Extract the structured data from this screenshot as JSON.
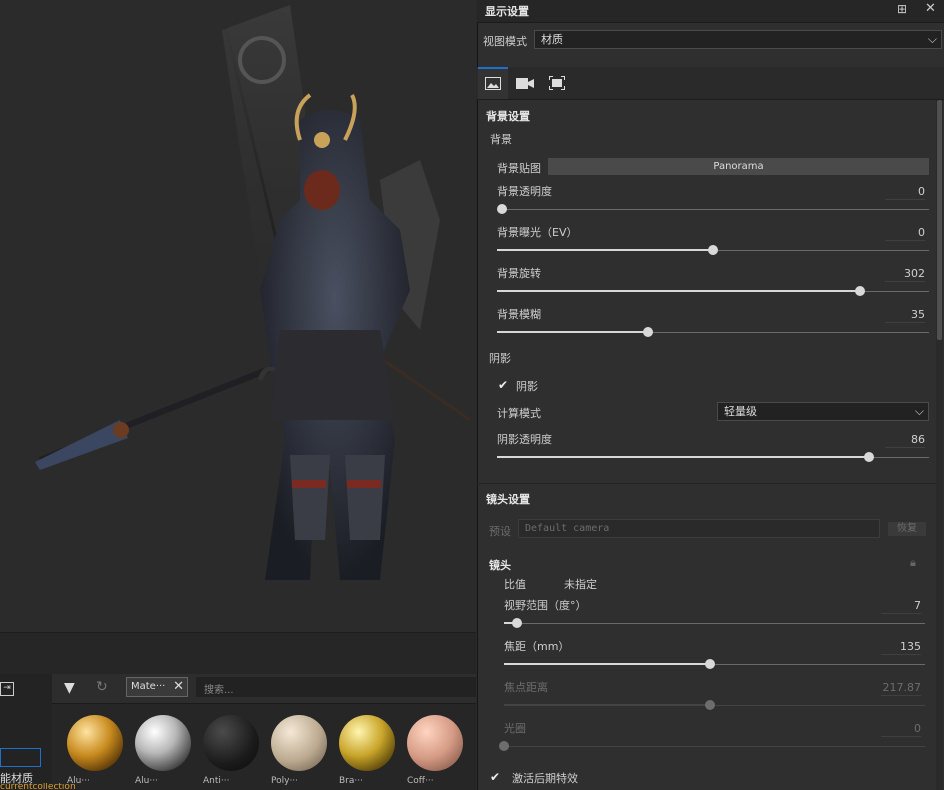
{
  "panel": {
    "title": "显示设置",
    "view_mode_label": "视图模式",
    "view_mode_value": "材质",
    "tabs": [
      {
        "icon": "image-icon"
      },
      {
        "icon": "camera-icon"
      },
      {
        "icon": "frame-icon"
      }
    ]
  },
  "background": {
    "section_title": "背景设置",
    "group_label": "背景",
    "map_label": "背景贴图",
    "map_value": "Panorama",
    "opacity_label": "背景透明度",
    "opacity_value": "0",
    "opacity_fraction": 0.0,
    "exposure_label": "背景曝光（EV）",
    "exposure_value": "0",
    "exposure_fraction": 0.5,
    "rotation_label": "背景旋转",
    "rotation_value": "302",
    "rotation_fraction": 0.84,
    "blur_label": "背景模糊",
    "blur_value": "35",
    "blur_fraction": 0.35
  },
  "shadow": {
    "group_label": "阴影",
    "checkbox_label": "阴影",
    "calc_mode_label": "计算模式",
    "calc_mode_value": "轻量级",
    "opacity_label": "阴影透明度",
    "opacity_value": "86",
    "opacity_fraction": 0.86
  },
  "lens": {
    "section_title": "镜头设置",
    "preset_label": "预设",
    "preset_placeholder": "Default camera",
    "preset_button": "恢复",
    "group_label": "镜头",
    "ratio_label": "比值",
    "ratio_value": "未指定",
    "fov_label": "视野范围（度°）",
    "fov_value": "7",
    "fov_fraction": 0.03,
    "focal_label": "焦距（mm）",
    "focal_value": "135",
    "focal_fraction": 0.49,
    "focus_label": "焦点距离",
    "focus_value": "217.87",
    "focus_fraction": 0.49,
    "aperture_label": "光圈",
    "aperture_value": "0",
    "aperture_fraction": 0.0,
    "postfx_label": "激活后期特效"
  },
  "library": {
    "filter_chip": "Mate···",
    "search_placeholder": "搜索...",
    "materials": [
      "Aluminium",
      "Aluminium",
      "Antifriction",
      "Polyethylene",
      "Brass",
      "Coffee"
    ],
    "material_labels": [
      "Alu···",
      "Alu···",
      "Anti···",
      "Poly···",
      "Bra···",
      "Coff···"
    ],
    "left_text": "能材质",
    "bottom_text": "currentcollection"
  },
  "colors": {
    "accent": "#1e6fd0",
    "panel_bg": "#2f2f2f",
    "viewport_bg": "#2b2b2b"
  }
}
